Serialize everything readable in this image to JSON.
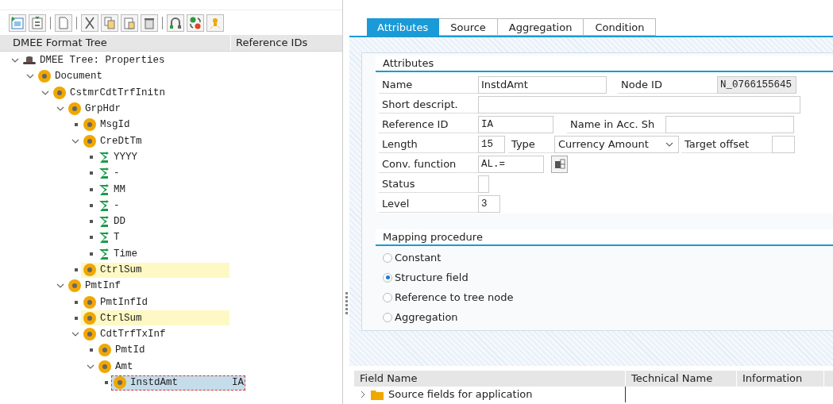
{
  "toolbar": [
    {
      "kind": "expand"
    },
    {
      "kind": "collapse"
    },
    {
      "kind": "sep"
    },
    {
      "kind": "new"
    },
    {
      "kind": "sep"
    },
    {
      "kind": "cut"
    },
    {
      "kind": "copy"
    },
    {
      "kind": "paste"
    },
    {
      "kind": "delete"
    },
    {
      "kind": "sep"
    },
    {
      "kind": "link"
    },
    {
      "kind": "swap"
    },
    {
      "kind": "lamp"
    }
  ],
  "tree_columns": [
    "DMEE Format Tree",
    "Reference IDs"
  ],
  "tree": [
    {
      "label": "DMEE Tree: Properties",
      "kind": "root",
      "expanded": true,
      "highlighted": false,
      "selected": false,
      "children": [
        {
          "label": "Document",
          "kind": "node",
          "expanded": true,
          "highlighted": false,
          "selected": false,
          "children": [
            {
              "label": "CstmrCdtTrfInitn",
              "kind": "node",
              "expanded": true,
              "highlighted": false,
              "selected": false,
              "children": [
                {
                  "label": "GrpHdr",
                  "kind": "node",
                  "expanded": true,
                  "highlighted": false,
                  "selected": false,
                  "children": [
                    {
                      "label": "MsgId",
                      "kind": "node",
                      "highlighted": false,
                      "selected": false
                    },
                    {
                      "label": "CreDtTm",
                      "kind": "node",
                      "expanded": true,
                      "highlighted": false,
                      "selected": false,
                      "children": [
                        {
                          "label": "YYYY",
                          "kind": "constant",
                          "highlighted": false,
                          "selected": false
                        },
                        {
                          "label": "-",
                          "kind": "constant",
                          "highlighted": false,
                          "selected": false
                        },
                        {
                          "label": "MM",
                          "kind": "constant",
                          "highlighted": false,
                          "selected": false
                        },
                        {
                          "label": "-",
                          "kind": "constant",
                          "highlighted": false,
                          "selected": false
                        },
                        {
                          "label": "DD",
                          "kind": "constant",
                          "highlighted": false,
                          "selected": false
                        },
                        {
                          "label": "T",
                          "kind": "constant",
                          "highlighted": false,
                          "selected": false
                        },
                        {
                          "label": "Time",
                          "kind": "constant",
                          "highlighted": false,
                          "selected": false
                        }
                      ]
                    },
                    {
                      "label": "CtrlSum",
                      "kind": "node",
                      "highlighted": true,
                      "selected": false
                    }
                  ]
                },
                {
                  "label": "PmtInf",
                  "kind": "node",
                  "expanded": true,
                  "highlighted": false,
                  "selected": false,
                  "children": [
                    {
                      "label": "PmtInfId",
                      "kind": "node",
                      "highlighted": false,
                      "selected": false
                    },
                    {
                      "label": "CtrlSum",
                      "kind": "node",
                      "highlighted": true,
                      "selected": false
                    },
                    {
                      "label": "CdtTrfTxInf",
                      "kind": "node",
                      "expanded": true,
                      "highlighted": false,
                      "selected": false,
                      "children": [
                        {
                          "label": "PmtId",
                          "kind": "node",
                          "highlighted": false,
                          "selected": false
                        },
                        {
                          "label": "Amt",
                          "kind": "node",
                          "expanded": true,
                          "highlighted": false,
                          "selected": false,
                          "children": [
                            {
                              "label": "InstdAmt",
                              "kind": "node",
                              "highlighted": false,
                              "selected": true,
                              "ref": "IA"
                            }
                          ]
                        }
                      ]
                    }
                  ]
                }
              ]
            }
          ]
        }
      ]
    }
  ],
  "tabs": [
    {
      "label": "Attributes",
      "selected": true
    },
    {
      "label": "Source",
      "selected": false
    },
    {
      "label": "Aggregation",
      "selected": false
    },
    {
      "label": "Condition",
      "selected": false
    }
  ],
  "attributes": {
    "title": "Attributes",
    "name": {
      "label": "Name",
      "value": "InstdAmt"
    },
    "node_id": {
      "label": "Node ID",
      "value": "N_0766155645"
    },
    "short_descript": {
      "label": "Short descript."
    },
    "reference_id": {
      "label": "Reference ID",
      "value": "IA"
    },
    "name_in_acc_sh": {
      "label": "Name in Acc. Sh"
    },
    "length": {
      "label": "Length",
      "value": "15"
    },
    "type": {
      "label": "Type",
      "value": "Currency Amount"
    },
    "target_offset": {
      "label": "Target offset"
    },
    "conv_function": {
      "label": "Conv. function",
      "value": "AL.="
    },
    "status": {
      "label": "Status"
    },
    "level": {
      "label": "Level",
      "value": "3"
    }
  },
  "mapping": {
    "title": "Mapping procedure",
    "options": [
      {
        "label": "Constant",
        "selected": false
      },
      {
        "label": "Structure field",
        "selected": true
      },
      {
        "label": "Reference to tree node",
        "selected": false
      },
      {
        "label": "Aggregation",
        "selected": false
      }
    ]
  },
  "fields_table": {
    "columns": [
      "Field Name",
      "Technical Name",
      "Information"
    ],
    "rows": [
      {
        "label": "Source fields for application",
        "expanded": false
      }
    ]
  }
}
